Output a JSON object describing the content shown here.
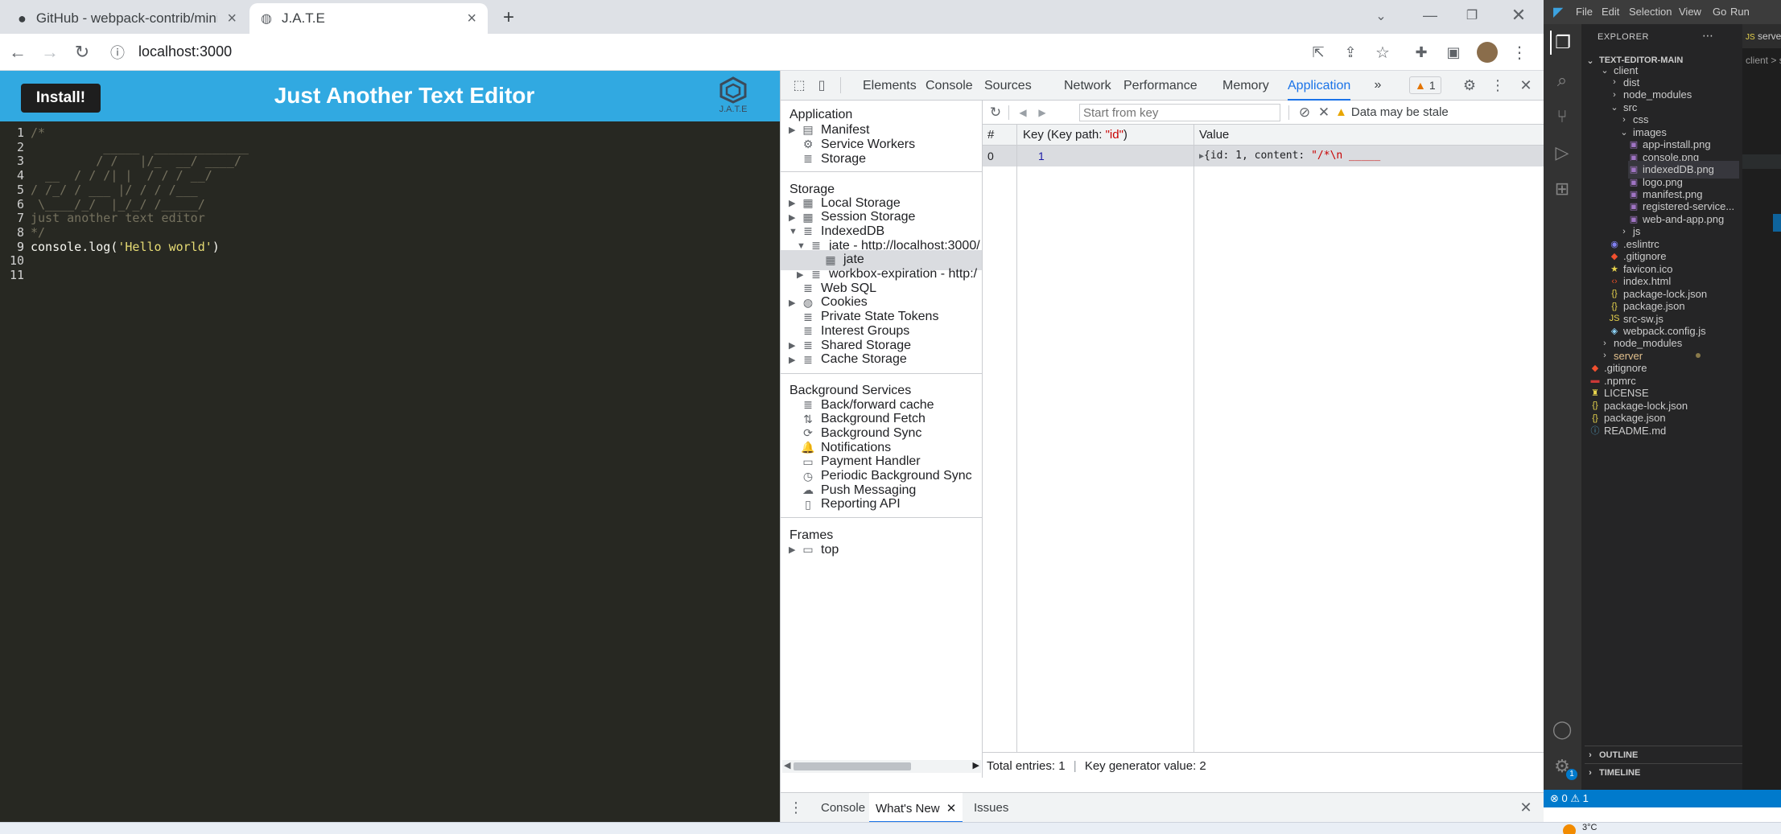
{
  "browser": {
    "tabs": [
      {
        "title": "GitHub - webpack-contrib/mini-c",
        "active": false
      },
      {
        "title": "J.A.T.E",
        "active": true
      }
    ],
    "url": "localhost:3000"
  },
  "app": {
    "install_label": "Install!",
    "title": "Just Another Text Editor",
    "logo_text": "J.A.T.E",
    "editor_lines": [
      {
        "n": "1",
        "text": "/*",
        "cls": "cm"
      },
      {
        "n": "2",
        "text": "          _____  _____________",
        "cls": "cm"
      },
      {
        "n": "3",
        "text": "         / /   |/_  __/ ____/",
        "cls": "cm"
      },
      {
        "n": "4",
        "text": "  __  / / /| |  / / / __/",
        "cls": "cm"
      },
      {
        "n": "5",
        "text": "/ /_/ / ___ |/ / / /___",
        "cls": "cm"
      },
      {
        "n": "6",
        "text": " \\____/_/  |_/_/ /_____/",
        "cls": "cm"
      },
      {
        "n": "7",
        "text": "just another text editor",
        "cls": "cm"
      },
      {
        "n": "8",
        "text": "*/",
        "cls": "cm"
      },
      {
        "n": "9",
        "text": "",
        "cls": ""
      },
      {
        "n": "10",
        "text": "",
        "cls": ""
      },
      {
        "n": "11",
        "text": "",
        "cls": ""
      }
    ],
    "code_line_9": {
      "a": "console.log(",
      "s": "'Hello world'",
      "b": ")"
    }
  },
  "devtools": {
    "tabs": [
      "Elements",
      "Console",
      "Sources",
      "Network",
      "Performance",
      "Memory",
      "Application"
    ],
    "active_tab": "Application",
    "issues_count": "1",
    "sidebar": {
      "application_header": "Application",
      "application_items": [
        "Manifest",
        "Service Workers",
        "Storage"
      ],
      "storage_header": "Storage",
      "storage_items": [
        "Local Storage",
        "Session Storage",
        "IndexedDB",
        "jate - http://localhost:3000/",
        "jate",
        "workbox-expiration - http:/",
        "Web SQL",
        "Cookies",
        "Private State Tokens",
        "Interest Groups",
        "Shared Storage",
        "Cache Storage"
      ],
      "background_header": "Background Services",
      "background_items": [
        "Back/forward cache",
        "Background Fetch",
        "Background Sync",
        "Notifications",
        "Payment Handler",
        "Periodic Background Sync",
        "Push Messaging",
        "Reporting API"
      ],
      "frames_header": "Frames",
      "frames_items": [
        "top"
      ]
    },
    "toolbar": {
      "key_placeholder": "Start from key",
      "stale_text": "Data may be stale"
    },
    "table": {
      "headers": [
        "#",
        "Key (Key path: \"id\")",
        "Value"
      ],
      "key_path": "id",
      "rows": [
        {
          "index": "0",
          "key": "1",
          "value_pre": "{id: 1, content: ",
          "value_str": "\"/*\\n          _____"
        }
      ]
    },
    "status": {
      "total": "Total entries: 1",
      "generator": "Key generator value: 2"
    },
    "drawer_tabs": [
      "Console",
      "What's New",
      "Issues"
    ]
  },
  "vscode": {
    "menu": [
      "File",
      "Edit",
      "Selection",
      "View",
      "Go",
      "Run"
    ],
    "tab_title": "server.js",
    "breadcrumb": "client > src",
    "explorer_title": "EXPLORER",
    "root": "TEXT-EDITOR-MAIN",
    "tree": [
      {
        "name": "client",
        "depth": 1,
        "kind": "folder-open",
        "color": "#cccccc"
      },
      {
        "name": "dist",
        "depth": 2,
        "kind": "folder",
        "color": "#cccccc"
      },
      {
        "name": "node_modules",
        "depth": 2,
        "kind": "folder",
        "color": "#cccccc"
      },
      {
        "name": "src",
        "depth": 2,
        "kind": "folder-open",
        "color": "#cccccc"
      },
      {
        "name": "css",
        "depth": 3,
        "kind": "folder",
        "color": "#cccccc"
      },
      {
        "name": "images",
        "depth": 3,
        "kind": "folder-open",
        "color": "#cccccc"
      },
      {
        "name": "app-install.png",
        "depth": 4,
        "kind": "image",
        "color": "#cccccc"
      },
      {
        "name": "console.png",
        "depth": 4,
        "kind": "image",
        "color": "#cccccc"
      },
      {
        "name": "indexedDB.png",
        "depth": 4,
        "kind": "image",
        "color": "#cccccc"
      },
      {
        "name": "logo.png",
        "depth": 4,
        "kind": "image",
        "color": "#cccccc"
      },
      {
        "name": "manifest.png",
        "depth": 4,
        "kind": "image",
        "color": "#cccccc"
      },
      {
        "name": "registered-service...",
        "depth": 4,
        "kind": "image",
        "color": "#cccccc"
      },
      {
        "name": "web-and-app.png",
        "depth": 4,
        "kind": "image",
        "color": "#cccccc"
      },
      {
        "name": "js",
        "depth": 3,
        "kind": "folder",
        "color": "#cccccc"
      },
      {
        "name": ".eslintrc",
        "depth": 2,
        "kind": "eslint",
        "color": "#cccccc"
      },
      {
        "name": ".gitignore",
        "depth": 2,
        "kind": "git",
        "color": "#cccccc"
      },
      {
        "name": "favicon.ico",
        "depth": 2,
        "kind": "star",
        "color": "#cccccc"
      },
      {
        "name": "index.html",
        "depth": 2,
        "kind": "html",
        "color": "#cccccc"
      },
      {
        "name": "package-lock.json",
        "depth": 2,
        "kind": "json",
        "color": "#cccccc"
      },
      {
        "name": "package.json",
        "depth": 2,
        "kind": "json",
        "color": "#cccccc"
      },
      {
        "name": "src-sw.js",
        "depth": 2,
        "kind": "js",
        "color": "#cccccc"
      },
      {
        "name": "webpack.config.js",
        "depth": 2,
        "kind": "webpack",
        "color": "#cccccc"
      },
      {
        "name": "node_modules",
        "depth": 1,
        "kind": "folder",
        "color": "#cccccc"
      },
      {
        "name": "server",
        "depth": 1,
        "kind": "folder",
        "color": "#e2c08d"
      },
      {
        "name": ".gitignore",
        "depth": 0,
        "kind": "git",
        "color": "#cccccc"
      },
      {
        "name": ".npmrc",
        "depth": 0,
        "kind": "npm",
        "color": "#cccccc"
      },
      {
        "name": "LICENSE",
        "depth": 0,
        "kind": "license",
        "color": "#cccccc"
      },
      {
        "name": "package-lock.json",
        "depth": 0,
        "kind": "json",
        "color": "#cccccc"
      },
      {
        "name": "package.json",
        "depth": 0,
        "kind": "json",
        "color": "#cccccc"
      },
      {
        "name": "README.md",
        "depth": 0,
        "kind": "info",
        "color": "#cccccc"
      }
    ],
    "outline": "OUTLINE",
    "timeline": "TIMELINE",
    "status_errors": "0",
    "status_warnings": "1",
    "account_badge": "1"
  },
  "taskbar": {
    "weather_temp": "3°C",
    "weather_text": "Sunny"
  },
  "colors": {
    "app_header": "#31a9e1",
    "editor_bg": "#272822",
    "devtools_accent": "#1a73e8",
    "vscode_status": "#007acc"
  }
}
